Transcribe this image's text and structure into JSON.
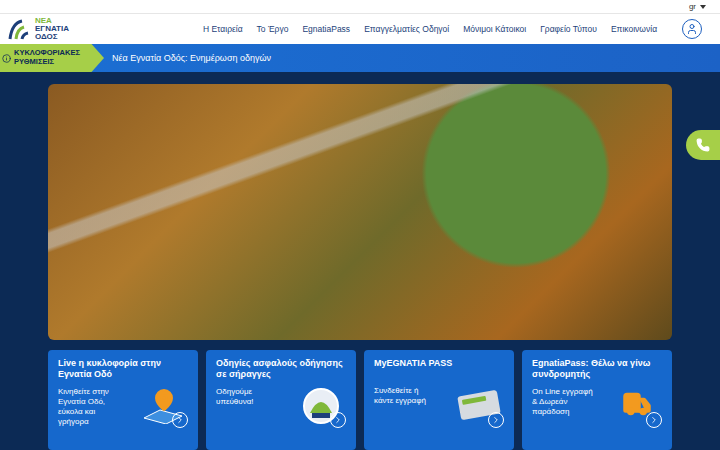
{
  "topbar": {
    "language": "gr"
  },
  "logo": {
    "lines": [
      "ΝΕΑ",
      "ΕΓΝΑΤΙΑ",
      "ΟΔΟΣ"
    ]
  },
  "nav": {
    "items": [
      "Η Εταιρεία",
      "Το Έργο",
      "EgnatiaPass",
      "Επαγγελματίες Οδηγοί",
      "Μόνιμοι Κάτοικοι",
      "Γραφείο Τύπου",
      "Επικοινωνία"
    ]
  },
  "alert": {
    "label": "ΚΥΚΛΟΦΟΡΙΑΚΕΣ ΡΥΘΜΙΣΕΙΣ",
    "text": "Νέα Εγνατία Οδός: Ενημέρωση οδηγών"
  },
  "cards": [
    {
      "kind": "map",
      "title": "Live η κυκλοφορία στην Εγνατία Οδό",
      "text": "Κινηθείτε στην Εγνατία Οδό, εύκολα και γρήγορα"
    },
    {
      "kind": "badge",
      "title": "Οδηγίες ασφαλούς οδήγησης σε σήραγγες",
      "text": "Οδηγούμε υπεύθυνα!"
    },
    {
      "kind": "pass",
      "title": "MyEGNATIA PASS",
      "text": "Συνδεθείτε ή κάντε εγγραφή"
    },
    {
      "kind": "truck",
      "title": "EgnatiaPass: Θέλω να γίνω συνδρομητής",
      "text": "On Line εγγραφή & Δωρεάν παράδοση"
    }
  ]
}
